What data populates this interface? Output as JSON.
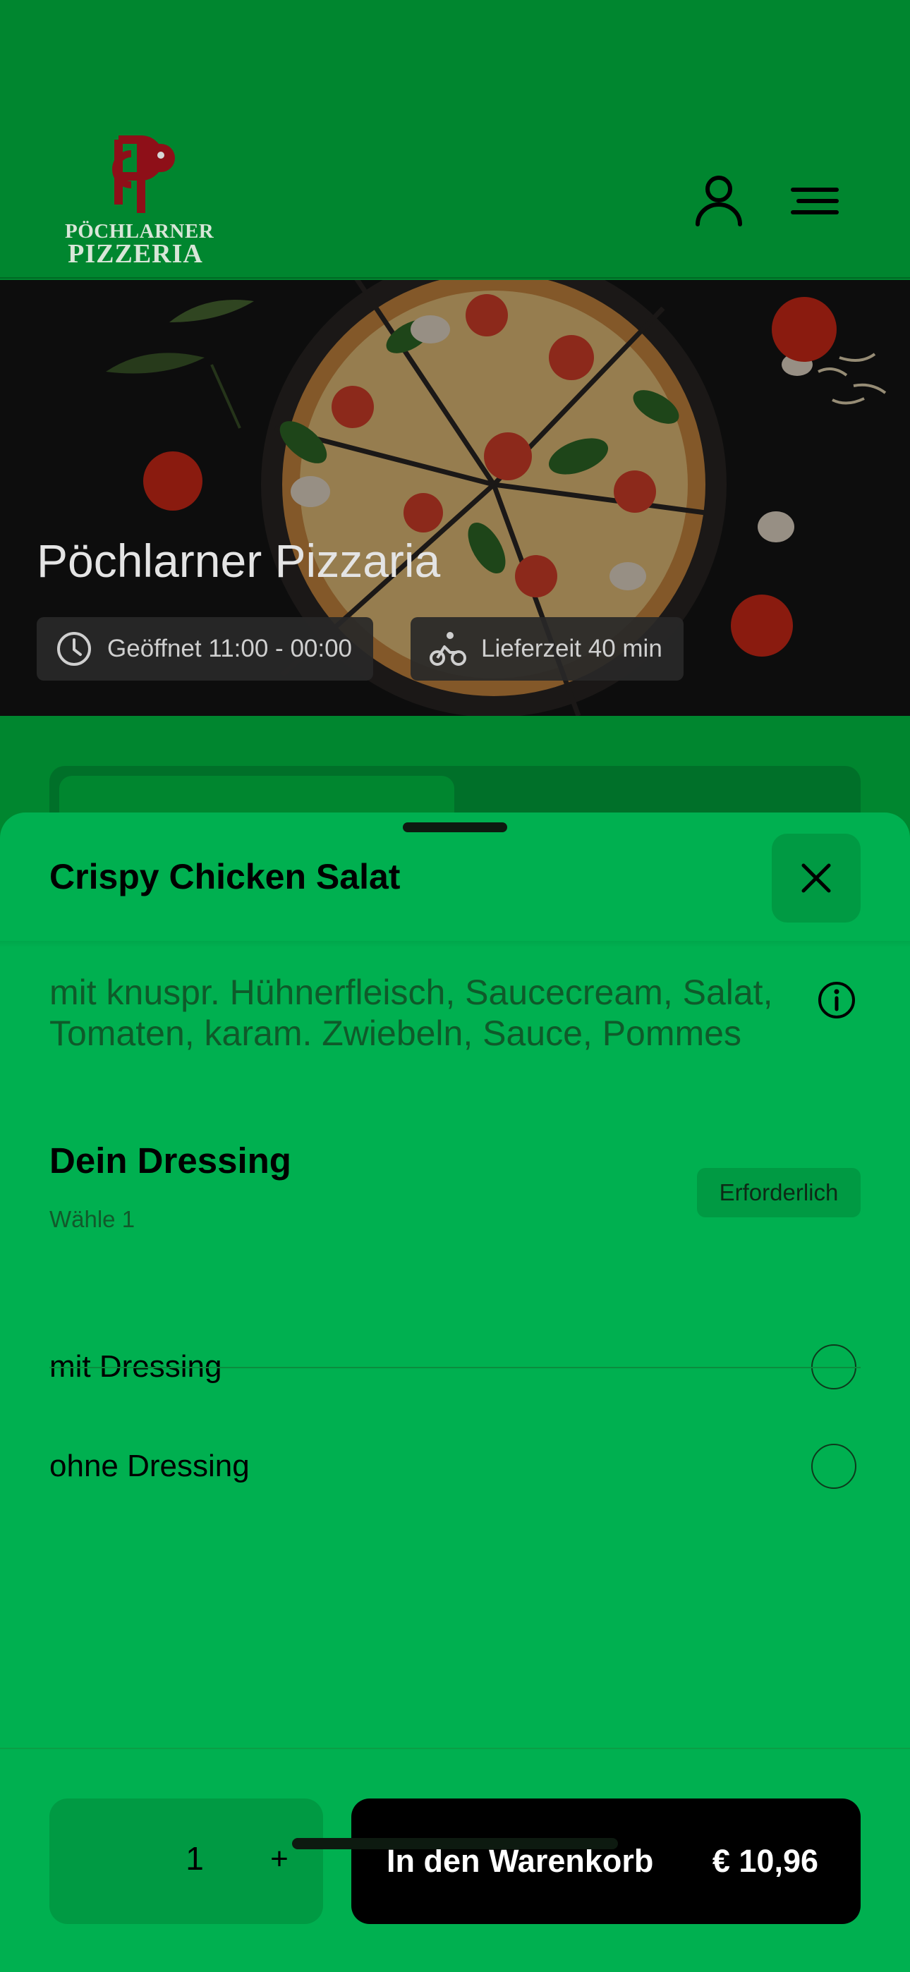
{
  "header": {
    "logo_line1": "PÖCHLARNER",
    "logo_line2": "PIZZERIA",
    "user_icon": "user-icon",
    "menu_icon": "menu-icon"
  },
  "hero": {
    "title": "Pöchlarner Pizzaria",
    "open_hours": "Geöffnet 11:00 - 00:00",
    "delivery_time": "Lieferzeit 40 min",
    "open_icon": "clock-icon",
    "delivery_icon": "bike-icon"
  },
  "sheet": {
    "title": "Crispy Chicken Salat",
    "close_icon": "close-icon",
    "description": "mit knuspr. Hühnerfleisch, Saucecream, Salat, Tomaten, karam. Zwiebeln, Sauce, Pommes",
    "info_icon": "info-icon",
    "section": {
      "title": "Dein Dressing",
      "subtitle": "Wähle 1",
      "badge": "Erforderlich",
      "options": [
        {
          "label": "mit Dressing",
          "selected": false
        },
        {
          "label": "ohne Dressing",
          "selected": false
        }
      ]
    },
    "footer": {
      "quantity": "1",
      "plus": "+",
      "cart_label": "In den Warenkorb",
      "price": "€ 10,96"
    }
  },
  "colors": {
    "header_bg": "#00862f",
    "sheet_bg": "#00b050",
    "accent": "#009a43",
    "logo_red": "#a3121b",
    "cart_button": "#000000"
  }
}
